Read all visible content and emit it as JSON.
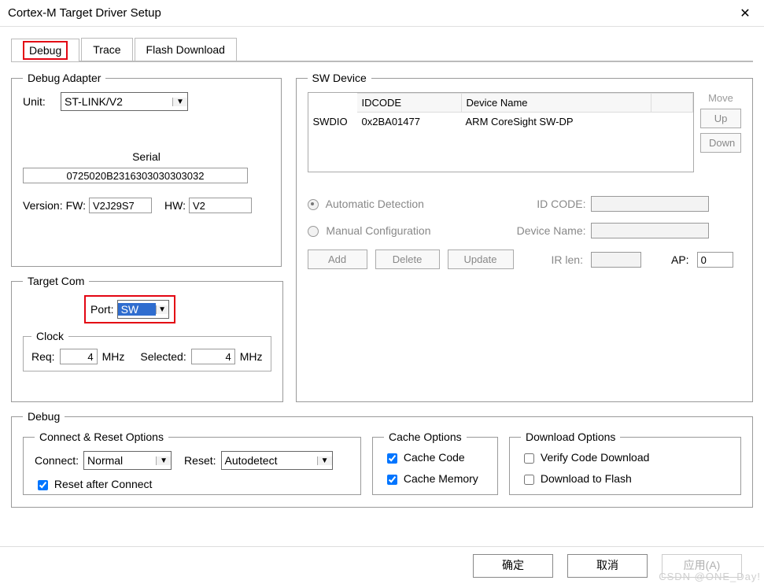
{
  "window": {
    "title": "Cortex-M Target Driver Setup"
  },
  "tabs": {
    "debug": "Debug",
    "trace": "Trace",
    "flash": "Flash Download"
  },
  "adapter": {
    "legend": "Debug Adapter",
    "unit_label": "Unit:",
    "unit_value": "ST-LINK/V2",
    "serial_label": "Serial",
    "serial_value": "0725020B2316303030303032",
    "version_label": "Version:",
    "fw_label": "FW:",
    "fw_value": "V2J29S7",
    "hw_label": "HW:",
    "hw_value": "V2"
  },
  "target": {
    "legend": "Target Com",
    "port_label": "Port:",
    "port_value": "SW",
    "clock_legend": "Clock",
    "req_label": "Req:",
    "req_value": "4",
    "mhz": "MHz",
    "selected_label": "Selected:",
    "selected_value": "4"
  },
  "sw": {
    "legend": "SW Device",
    "col_idcode": "IDCODE",
    "col_devname": "Device Name",
    "rowhdr": "SWDIO",
    "idcode_val": "0x2BA01477",
    "devname_val": "ARM CoreSight SW-DP",
    "move": "Move",
    "up": "Up",
    "down": "Down",
    "auto": "Automatic Detection",
    "manual": "Manual Configuration",
    "idcode_label": "ID CODE:",
    "devname_label": "Device Name:",
    "irlen_label": "IR len:",
    "ap_label": "AP:",
    "ap_value": "0",
    "add": "Add",
    "delete": "Delete",
    "update": "Update"
  },
  "debug": {
    "legend": "Debug",
    "connect_legend": "Connect & Reset Options",
    "connect_label": "Connect:",
    "connect_value": "Normal",
    "reset_label": "Reset:",
    "reset_value": "Autodetect",
    "reset_after": "Reset after Connect",
    "cache_legend": "Cache Options",
    "cache_code": "Cache Code",
    "cache_memory": "Cache Memory",
    "download_legend": "Download Options",
    "verify": "Verify Code Download",
    "dl_to_flash": "Download to Flash"
  },
  "buttons": {
    "ok": "确定",
    "cancel": "取消",
    "apply": "应用(A)"
  },
  "watermark": "CSDN @ONE_Day!"
}
